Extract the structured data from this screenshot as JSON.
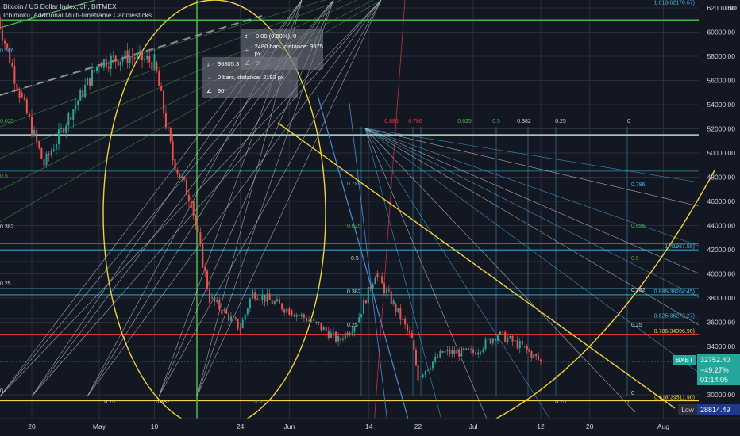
{
  "header": {
    "title": "Bitcoin / US Dollar Index, 3h, BITMEX",
    "subtitle": "Ichimoku, Additional Multi-timeframe Candlesticks"
  },
  "currency": "USD",
  "price_axis": {
    "ticks": [
      62000,
      60000,
      58000,
      56000,
      54000,
      52000,
      50000,
      48000,
      46000,
      44000,
      42000,
      40000,
      38000,
      36000,
      34000,
      30000
    ],
    "tick_labels": [
      "62000.00",
      "60000.00",
      "58000.00",
      "56000.00",
      "54000.00",
      "52000.00",
      "50000.00",
      "48000.00",
      "46000.00",
      "44000.00",
      "42000.00",
      "40000.00",
      "38000.00",
      "36000.00",
      "34000.00",
      "30000.00"
    ]
  },
  "time_axis": {
    "labels": [
      "20",
      "May",
      "10",
      "24",
      "Jun",
      "14",
      "22",
      "Jul",
      "12",
      "20",
      "Aug"
    ]
  },
  "last_price": {
    "symbol": "BXBT",
    "value": "32752.40",
    "change": "−49.27%",
    "countdown": "01:14:05"
  },
  "low_marker": {
    "label": "Low",
    "value": "28814.49"
  },
  "tooltips": [
    {
      "rows": [
        "0.00 (0.00%), 0",
        "2480 bars, distance: 3975 px",
        "0°"
      ]
    },
    {
      "rows": [
        "96805.3",
        "0 bars, distance: 2192 px",
        "90°"
      ]
    }
  ],
  "fib_labels": {
    "right": [
      "1.618(62170.67)",
      "1(41987.55)",
      "0.886(38264.45)",
      "0.825(36272.27)",
      "0.786(34996.90)",
      "0.618(29511.90)"
    ],
    "fan_top": [
      "0.886",
      "0.786",
      "0.625",
      "0.5",
      "0.382",
      "0.25",
      "0"
    ],
    "fan_right": [
      "0.786",
      "0.625",
      "0.5",
      "0.382",
      "0.25",
      "0"
    ],
    "fan_mid": [
      "0.786",
      "0.625",
      "0.5",
      "0.382",
      "0.25"
    ],
    "left": [
      "0.786",
      "0.625",
      "0.5",
      "0.382",
      "0.25",
      "0"
    ],
    "bottom": [
      "0.25",
      "0.382",
      "0.5",
      "0.25",
      "0"
    ]
  },
  "colors": {
    "background": "#131722",
    "up": "#26a69a",
    "down": "#ef5350",
    "gridline": "#2a2e39",
    "green_line": "#4caf50",
    "yellow_line": "#f2d33a",
    "red_line": "#f23645",
    "blue_line": "#4a8bd6",
    "cyan_line": "#43b6e0",
    "white_line": "#d1d4dc",
    "mint_line": "#b4e0c6"
  },
  "chart_data": {
    "type": "candlestick",
    "title": "Bitcoin / US Dollar Index, 3h, BITMEX",
    "ylim": [
      28000,
      63000
    ],
    "y_scale": "linear",
    "x_range": [
      "Apr 14",
      "Aug 4"
    ],
    "grid": true,
    "price_path": [
      {
        "date": "Apr 14",
        "close": 62000
      },
      {
        "date": "Apr 18",
        "close": 55000
      },
      {
        "date": "Apr 22",
        "close": 49000
      },
      {
        "date": "Apr 26",
        "close": 53000
      },
      {
        "date": "May 1",
        "close": 57500
      },
      {
        "date": "May 6",
        "close": 58000
      },
      {
        "date": "May 10",
        "close": 57500
      },
      {
        "date": "May 13",
        "close": 49500
      },
      {
        "date": "May 16",
        "close": 46000
      },
      {
        "date": "May 19",
        "close": 38000
      },
      {
        "date": "May 21",
        "close": 37000
      },
      {
        "date": "May 24",
        "close": 35500
      },
      {
        "date": "May 26",
        "close": 38500
      },
      {
        "date": "Jun 1",
        "close": 37000
      },
      {
        "date": "Jun 5",
        "close": 36000
      },
      {
        "date": "Jun 9",
        "close": 34500
      },
      {
        "date": "Jun 12",
        "close": 36000
      },
      {
        "date": "Jun 15",
        "close": 40000
      },
      {
        "date": "Jun 18",
        "close": 37500
      },
      {
        "date": "Jun 21",
        "close": 34500
      },
      {
        "date": "Jun 22",
        "close": 31500
      },
      {
        "date": "Jun 26",
        "close": 33500
      },
      {
        "date": "Jul 1",
        "close": 33500
      },
      {
        "date": "Jul 5",
        "close": 35000
      },
      {
        "date": "Jul 9",
        "close": 34000
      },
      {
        "date": "Jul 12",
        "close": 32752
      }
    ],
    "horizontal_levels": [
      {
        "label": "1.618(62170.67)",
        "value": 62170.67
      },
      {
        "label": "1(41987.55)",
        "value": 41987.55
      },
      {
        "label": "0.886(38264.45)",
        "value": 38264.45
      },
      {
        "label": "0.825(36272.27)",
        "value": 36272.27
      },
      {
        "label": "0.786(34996.90)",
        "value": 34996.9
      },
      {
        "label": "0.618(29511.90)",
        "value": 29511.9
      }
    ],
    "last_price": 32752.4,
    "low": 28814.49
  }
}
